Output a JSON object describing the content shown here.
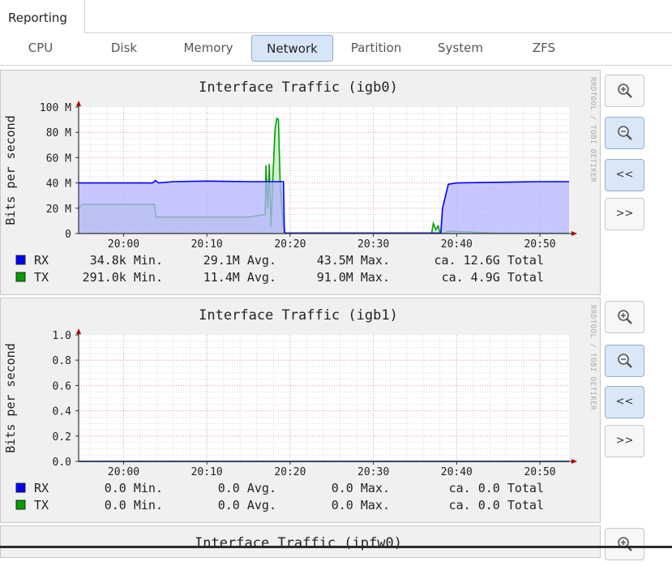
{
  "page_tab": "Reporting",
  "subtabs": [
    "CPU",
    "Disk",
    "Memory",
    "Network",
    "Partition",
    "System",
    "ZFS"
  ],
  "active_subtab": "Network",
  "controls": {
    "zoom_in": "zoom-in-icon",
    "zoom_out": "zoom-out-icon",
    "back": "<<",
    "forward": ">>"
  },
  "watermark": "RRDTOOL / TOBI OETIKER",
  "colors": {
    "rx": "#0000ff",
    "tx": "#00a000",
    "rx_fill": "#b4b4ff",
    "tx_fill": "#b4e6b4",
    "active_tab": "#d6e6f7"
  },
  "chart_data": [
    {
      "type": "area",
      "title": "Interface Traffic (igb0)",
      "ylabel": "Bits per second",
      "y_ticks": [
        "100 M",
        "80 M",
        "60 M",
        "40 M",
        "20 M",
        "0"
      ],
      "ylim": [
        0,
        100000000
      ],
      "x_ticks": [
        "20:00",
        "20:10",
        "20:20",
        "20:30",
        "20:40",
        "20:50"
      ],
      "x_tick_minutes": [
        0,
        10,
        20,
        30,
        40,
        50
      ],
      "xlim_minutes": [
        -5.4,
        53.5
      ],
      "grid": true,
      "series": [
        {
          "name": "RX",
          "x_minutes": [
            -5.4,
            3.5,
            3.8,
            4.2,
            6.0,
            10,
            15,
            18,
            19.2,
            19.3,
            19.35,
            38.1,
            38.3,
            39,
            40,
            45,
            50,
            53.5
          ],
          "values": [
            40000000,
            40000000,
            42000000,
            40000000,
            41000000,
            41500000,
            41000000,
            41000000,
            41000000,
            5000000,
            400000,
            400000,
            20000000,
            39000000,
            40000000,
            40500000,
            41000000,
            41000000
          ]
        },
        {
          "name": "TX",
          "x_minutes": [
            -5.4,
            -5,
            0,
            3.7,
            3.9,
            10,
            15,
            17,
            17.1,
            17.3,
            17.5,
            17.7,
            17.9,
            18.0,
            18.2,
            18.4,
            18.6,
            18.8,
            19.0,
            19.2,
            19.3,
            30,
            37,
            37.2,
            37.5,
            37.8,
            38.0,
            38.5,
            39,
            45,
            53.5
          ],
          "values": [
            20000000,
            23000000,
            23000000,
            23000000,
            13000000,
            13000000,
            13000000,
            15000000,
            54000000,
            20000000,
            55000000,
            5000000,
            40000000,
            55000000,
            83000000,
            91000000,
            90000000,
            40000000,
            20000000,
            5000000,
            300000,
            300000,
            300000,
            8000000,
            3000000,
            6000000,
            300000,
            300000,
            2000000,
            300000,
            300000
          ]
        }
      ],
      "legend": [
        {
          "name": "RX",
          "min": "34.8k Min.",
          "avg": "29.1M Avg.",
          "max": "43.5M Max.",
          "total": "ca.   12.6G Total"
        },
        {
          "name": "TX",
          "min": "291.0k Min.",
          "avg": "11.4M Avg.",
          "max": "91.0M Max.",
          "total": "ca.    4.9G Total"
        }
      ]
    },
    {
      "type": "area",
      "title": "Interface Traffic (igb1)",
      "ylabel": "Bits per second",
      "y_ticks": [
        "1.0",
        "0.8",
        "0.6",
        "0.4",
        "0.2",
        "0.0"
      ],
      "ylim": [
        0,
        1.0
      ],
      "x_ticks": [
        "20:00",
        "20:10",
        "20:20",
        "20:30",
        "20:40",
        "20:50"
      ],
      "x_tick_minutes": [
        0,
        10,
        20,
        30,
        40,
        50
      ],
      "xlim_minutes": [
        -5.4,
        53.5
      ],
      "grid": true,
      "series": [
        {
          "name": "RX",
          "x_minutes": [
            -5.4,
            53.5
          ],
          "values": [
            0,
            0
          ]
        },
        {
          "name": "TX",
          "x_minutes": [
            -5.4,
            53.5
          ],
          "values": [
            0,
            0
          ]
        }
      ],
      "legend": [
        {
          "name": "RX",
          "min": "0.0 Min.",
          "avg": "0.0 Avg.",
          "max": "0.0 Max.",
          "total": "ca.    0.0 Total"
        },
        {
          "name": "TX",
          "min": "0.0 Min.",
          "avg": "0.0 Avg.",
          "max": "0.0 Max.",
          "total": "ca.    0.0 Total"
        }
      ]
    },
    {
      "type": "area",
      "title": "Interface Traffic (ipfw0)"
    }
  ]
}
